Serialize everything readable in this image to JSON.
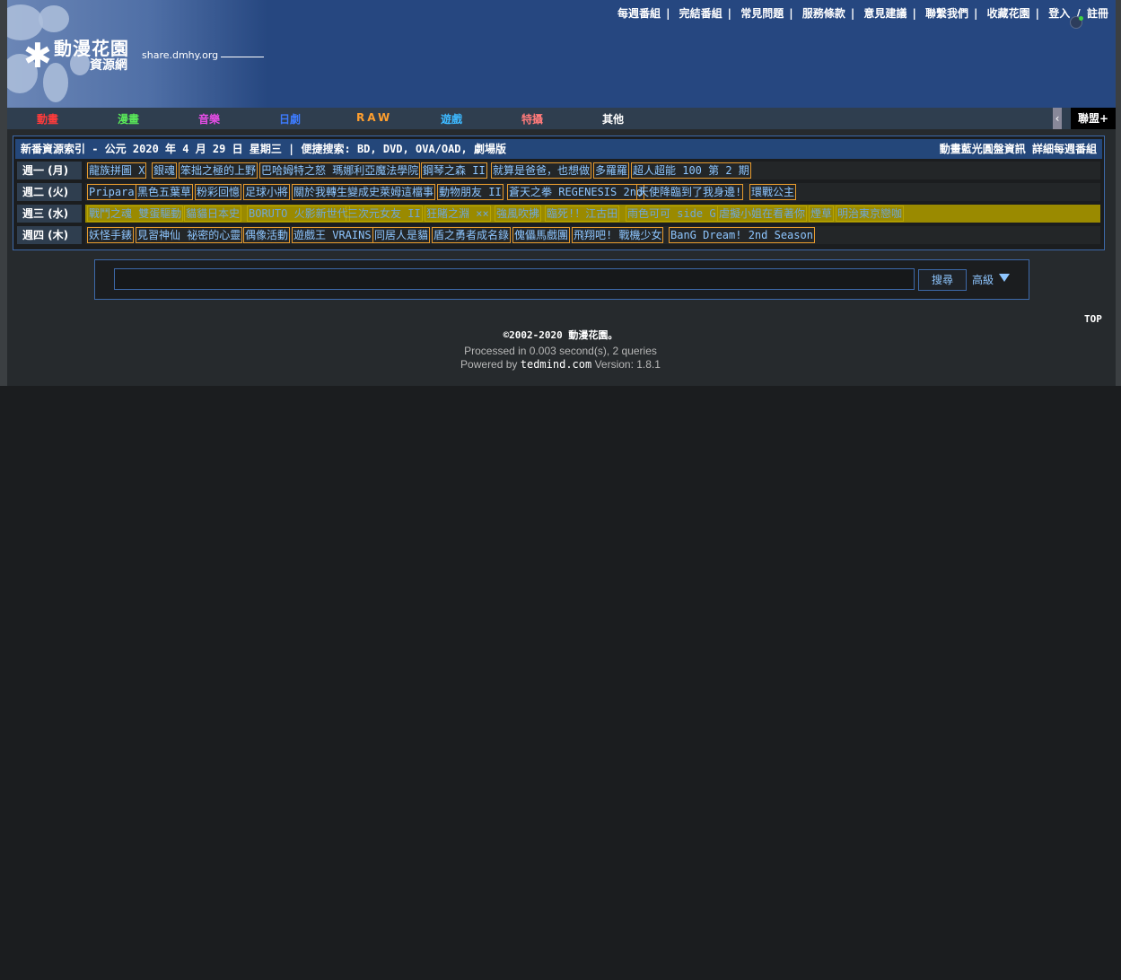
{
  "header": {
    "logo_title": "動漫花園",
    "logo_subtitle": "資源網",
    "logo_domain": "share.dmhy.org",
    "nav": [
      "每週番組",
      "完結番組",
      "常見問題",
      "服務條款",
      "意見建議",
      "聯繫我們",
      "收藏花園"
    ],
    "login": "登入",
    "slash": "/",
    "register": "註冊"
  },
  "categories": [
    {
      "label": "動畫",
      "color": "#ff3b3b"
    },
    {
      "label": "漫畫",
      "color": "#59e659"
    },
    {
      "label": "音樂",
      "color": "#e64de6"
    },
    {
      "label": "日劇",
      "color": "#3d7bff"
    },
    {
      "label": "RAW",
      "color": "#ff9f2e"
    },
    {
      "label": "遊戲",
      "color": "#3db8ff"
    },
    {
      "label": "特攝",
      "color": "#ff7a7a"
    },
    {
      "label": "其他",
      "color": "#ffffff"
    }
  ],
  "union_label": "聯盟+",
  "schedule": {
    "title": "新番資源索引 - 公元 2020 年 4 月 29 日 星期三 | 便捷搜索: BD, DVD, OVA/OAD, 劇場版",
    "right": "動畫藍光圓盤資訊 詳細每週番組",
    "rows": [
      {
        "day": "週一 (月)",
        "items": [
          "龍族拼圖 X",
          "銀魂",
          "笨拙之極的上野",
          "巴哈姆特之怒 瑪娜利亞魔法學院",
          "鋼琴之森 II",
          "就算是爸爸，也想做",
          "多羅羅",
          "超人超能 100 第 2 期"
        ]
      },
      {
        "day": "週二 (火)",
        "items": [
          "Pripara",
          "黑色五葉草",
          "粉彩回憶",
          "足球小將",
          "關於我轉生變成史萊姆這檔事",
          "動物朋友 II",
          "蒼天之拳 REGENESIS 2nd",
          "天使降臨到了我身邊!",
          "環戰公主"
        ]
      },
      {
        "day": "週三 (水)",
        "items": [
          "戰鬥之魂 雙蛋驅動",
          "貓貓日本史",
          "BORUTO 火影新世代",
          "三次元女友 II",
          "狂賭之淵 ××",
          "強風吹拂",
          "臨死!！江古田",
          "雨色可可 side G",
          "虐擬小姐在看著你",
          "煙草",
          "明治東京戀咖"
        ]
      },
      {
        "day": "週四 (木)",
        "items": [
          "妖怪手錶",
          "見習神仙 祕密的心靈",
          "偶像活動",
          "遊戲王 VRAINS",
          "同居人是貓",
          "盾之勇者成名錄",
          "傀儡馬戲團",
          "飛翔吧! 戰機少女",
          "BanG Dream! 2nd Season"
        ]
      }
    ]
  },
  "search": {
    "value": "",
    "button": "搜尋",
    "advanced": "高級"
  },
  "footer": {
    "top": "TOP",
    "copyright": "©2002-2020 動漫花園。",
    "processed": "Processed in 0.003 second(s), 2 queries",
    "powered_prefix": "Powered by ",
    "powered_name": "tedmind.com",
    "powered_suffix": " Version: 1.8.1"
  }
}
